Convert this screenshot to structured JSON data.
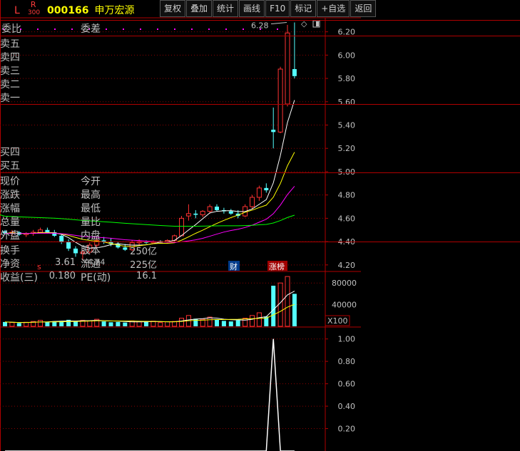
{
  "toolbar": {
    "buttons": [
      "复权",
      "叠加",
      "统计",
      "画线",
      "F10",
      "标记",
      "+自选",
      "返回"
    ]
  },
  "quote": {
    "l_badge": "L",
    "r_badge": "R",
    "r_sub": "300",
    "code": "000166",
    "name": "申万宏源",
    "weibi_label": "委比",
    "weicha_label": "委差",
    "sell_labels": [
      "卖五",
      "卖四",
      "卖三",
      "卖二",
      "卖一"
    ],
    "buy_labels": [
      "买四",
      "买五"
    ],
    "stats_left": [
      "现价",
      "涨跌",
      "涨幅",
      "总量",
      "外盘"
    ],
    "stats_right": [
      "今开",
      "最高",
      "最低",
      "量比",
      "内盘"
    ],
    "fin_rows": [
      {
        "l": "换手",
        "lv": "",
        "r": "股本",
        "rv": "250亿"
      },
      {
        "l": "净资",
        "lv": "3.61",
        "r": "流通",
        "rv": "225亿"
      },
      {
        "l": "收益(三)",
        "lv": "0.180",
        "r": "PE(动)",
        "rv": "16.1"
      }
    ]
  },
  "chart_data": [
    {
      "type": "candlestick",
      "panel": "price",
      "y_ticks": [
        "6.20",
        "6.00",
        "5.80",
        "5.60",
        "5.40",
        "5.20",
        "5.00",
        "4.80",
        "4.60",
        "4.40",
        "4.20"
      ],
      "ylim": [
        4.15,
        6.32
      ],
      "annotations": {
        "high": "6.28",
        "low": "4.24"
      },
      "markers": [
        "s",
        "财",
        "涨榜"
      ],
      "candles": [
        [
          4.49,
          4.5,
          4.46,
          4.47
        ],
        [
          4.47,
          4.5,
          4.45,
          4.48
        ],
        [
          4.48,
          4.49,
          4.45,
          4.46
        ],
        [
          4.46,
          4.48,
          4.44,
          4.47
        ],
        [
          4.47,
          4.5,
          4.45,
          4.48
        ],
        [
          4.48,
          4.52,
          4.47,
          4.5
        ],
        [
          4.5,
          4.52,
          4.47,
          4.48
        ],
        [
          4.48,
          4.5,
          4.44,
          4.45
        ],
        [
          4.45,
          4.47,
          4.38,
          4.4
        ],
        [
          4.4,
          4.42,
          4.32,
          4.34
        ],
        [
          4.34,
          4.36,
          4.27,
          4.3
        ],
        [
          4.3,
          4.33,
          4.24,
          4.31
        ],
        [
          4.31,
          4.39,
          4.3,
          4.37
        ],
        [
          4.37,
          4.43,
          4.35,
          4.41
        ],
        [
          4.41,
          4.44,
          4.38,
          4.4
        ],
        [
          4.4,
          4.43,
          4.36,
          4.38
        ],
        [
          4.38,
          4.4,
          4.34,
          4.35
        ],
        [
          4.35,
          4.38,
          4.32,
          4.33
        ],
        [
          4.33,
          4.41,
          4.32,
          4.39
        ],
        [
          4.39,
          4.42,
          4.37,
          4.4
        ],
        [
          4.4,
          4.41,
          4.38,
          4.39
        ],
        [
          4.39,
          4.41,
          4.38,
          4.4
        ],
        [
          4.4,
          4.41,
          4.39,
          4.4
        ],
        [
          4.4,
          4.42,
          4.39,
          4.41
        ],
        [
          4.41,
          4.46,
          4.4,
          4.45
        ],
        [
          4.45,
          4.62,
          4.45,
          4.6
        ],
        [
          4.62,
          4.72,
          4.58,
          4.64
        ],
        [
          4.64,
          4.67,
          4.6,
          4.63
        ],
        [
          4.63,
          4.67,
          4.61,
          4.66
        ],
        [
          4.66,
          4.72,
          4.64,
          4.7
        ],
        [
          4.7,
          4.72,
          4.66,
          4.67
        ],
        [
          4.67,
          4.69,
          4.64,
          4.66
        ],
        [
          4.66,
          4.68,
          4.63,
          4.64
        ],
        [
          4.64,
          4.67,
          4.6,
          4.62
        ],
        [
          4.62,
          4.72,
          4.61,
          4.7
        ],
        [
          4.7,
          4.8,
          4.68,
          4.78
        ],
        [
          4.78,
          4.88,
          4.75,
          4.86
        ],
        [
          4.86,
          4.9,
          4.82,
          4.84
        ],
        [
          5.36,
          5.55,
          5.2,
          5.34
        ],
        [
          5.34,
          5.9,
          5.33,
          5.88
        ],
        [
          5.58,
          6.26,
          5.56,
          6.19
        ],
        [
          5.88,
          6.28,
          5.8,
          5.82
        ]
      ]
    },
    {
      "type": "bar",
      "panel": "volume",
      "y_ticks": [
        "80000",
        "40000"
      ],
      "unit_label": "X100",
      "ylim": [
        0,
        100000
      ],
      "values": [
        8000,
        7000,
        6000,
        7500,
        9000,
        11000,
        8000,
        9500,
        10000,
        12000,
        9000,
        11000,
        10000,
        13000,
        9000,
        7500,
        8000,
        7000,
        10000,
        9000,
        8000,
        9500,
        7000,
        8500,
        9000,
        15000,
        20000,
        14000,
        13000,
        17000,
        12000,
        10000,
        9000,
        11000,
        15000,
        20000,
        25000,
        18000,
        75000,
        80000,
        92000,
        60000
      ]
    },
    {
      "type": "line",
      "panel": "indicator",
      "y_ticks": [
        "1.00",
        "0.80",
        "0.60",
        "0.40",
        "0.20"
      ],
      "ylim": [
        0,
        1.1
      ]
    }
  ]
}
